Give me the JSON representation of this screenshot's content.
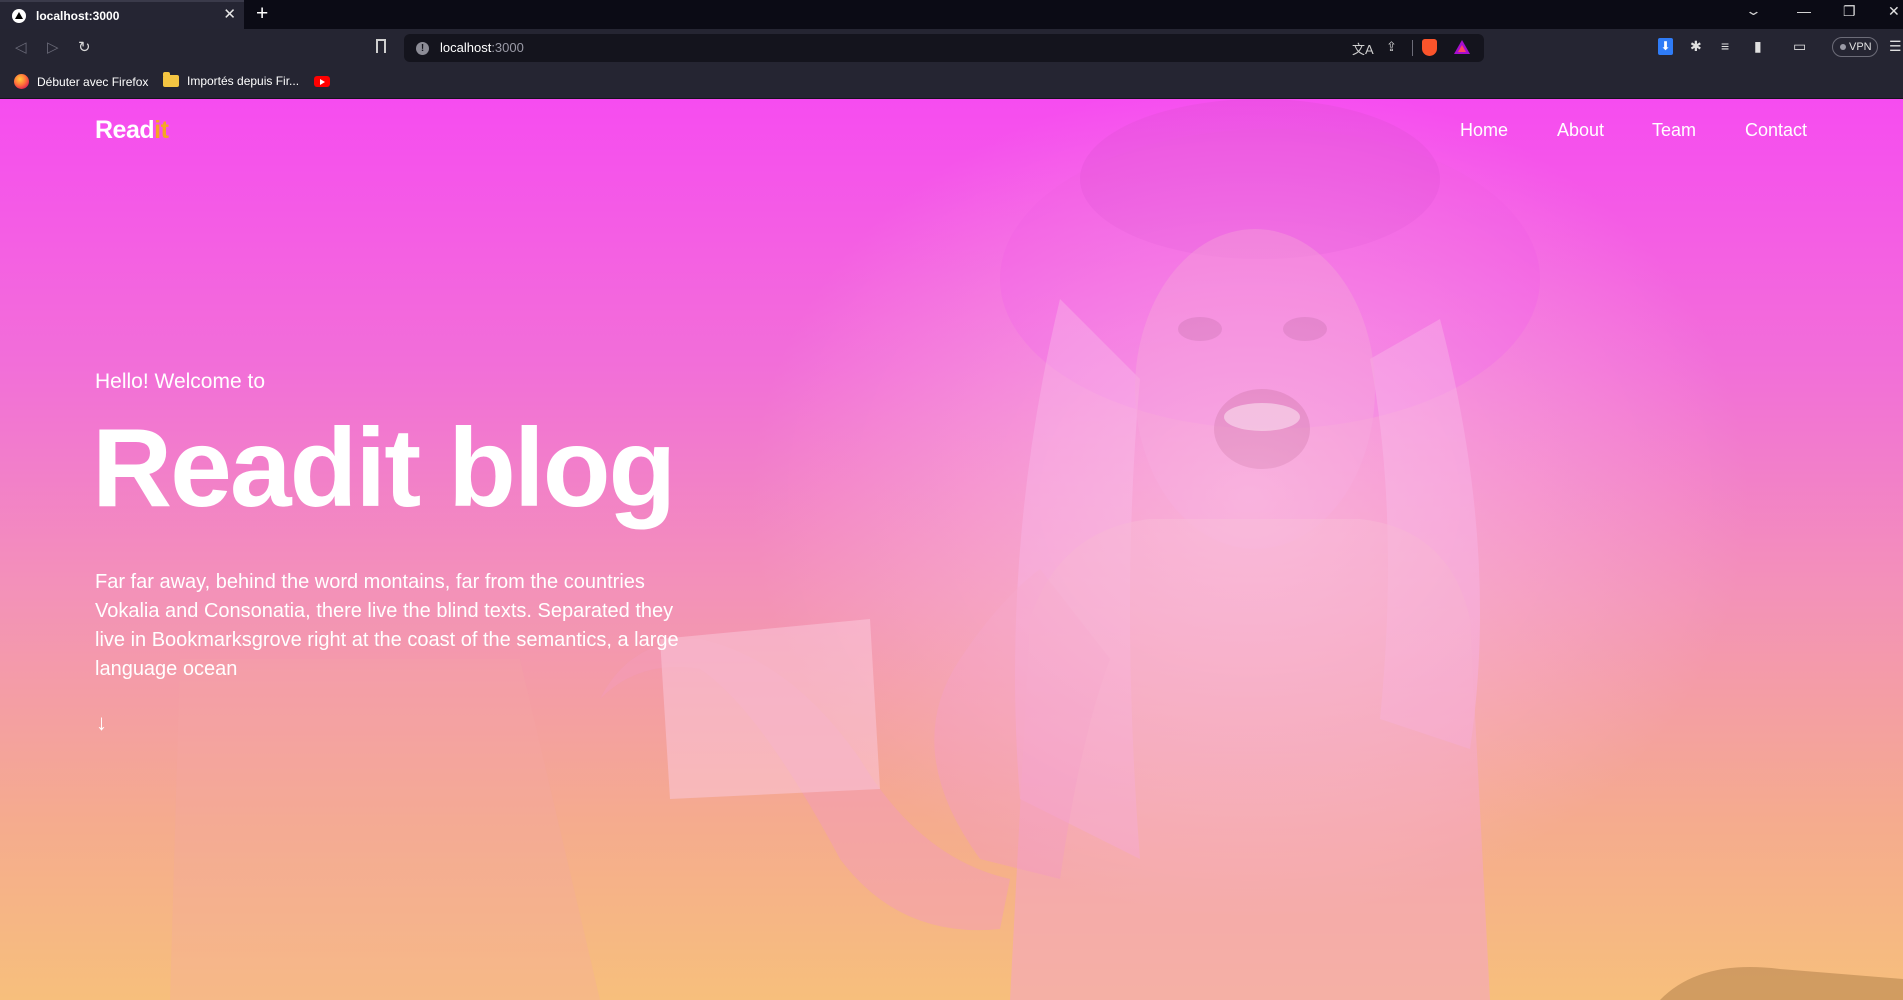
{
  "browser": {
    "tab": {
      "title": "localhost:3000",
      "close": "✕"
    },
    "new_tab": "+",
    "tab_dropdown": "⌄",
    "window_controls": {
      "minimize": "—",
      "restore": "❐",
      "close": "✕"
    },
    "nav": {
      "back": "◁",
      "forward": "▷",
      "reload": "↻"
    },
    "address": {
      "host": "localhost",
      "port": ":3000",
      "info_icon": "!"
    },
    "url_icons": {
      "translate": "文A",
      "share": "⇪"
    },
    "extensions": {
      "download": "⬇",
      "puzzle": "✱",
      "playlist": "≡",
      "sidebar": "▮",
      "wallet": "▭",
      "menu": "☰"
    },
    "vpn_label": "VPN",
    "bookmarks": [
      {
        "label": "Débuter avec Firefox",
        "icon": "firefox-icon"
      },
      {
        "label": "Importés depuis Fir...",
        "icon": "folder-icon"
      },
      {
        "label": "",
        "icon": "youtube-icon"
      }
    ]
  },
  "site": {
    "logo": {
      "part1": "Read",
      "part2": "it"
    },
    "nav": [
      "Home",
      "About",
      "Team",
      "Contact"
    ],
    "hero": {
      "subtitle": "Hello! Welcome to",
      "title": "Readit blog",
      "description": "Far far away, behind the word montains, far from the countries Vokalia and Consonatia, there live the blind texts. Separated they live in Bookmarksgrove right at the coast of the semantics, a large language ocean",
      "scroll_arrow": "↓"
    }
  },
  "colors": {
    "gradient_top": "#f64cf0",
    "gradient_bottom": "#f7bf7c",
    "logo_accent": "#f5a623",
    "text": "#ffffff"
  }
}
